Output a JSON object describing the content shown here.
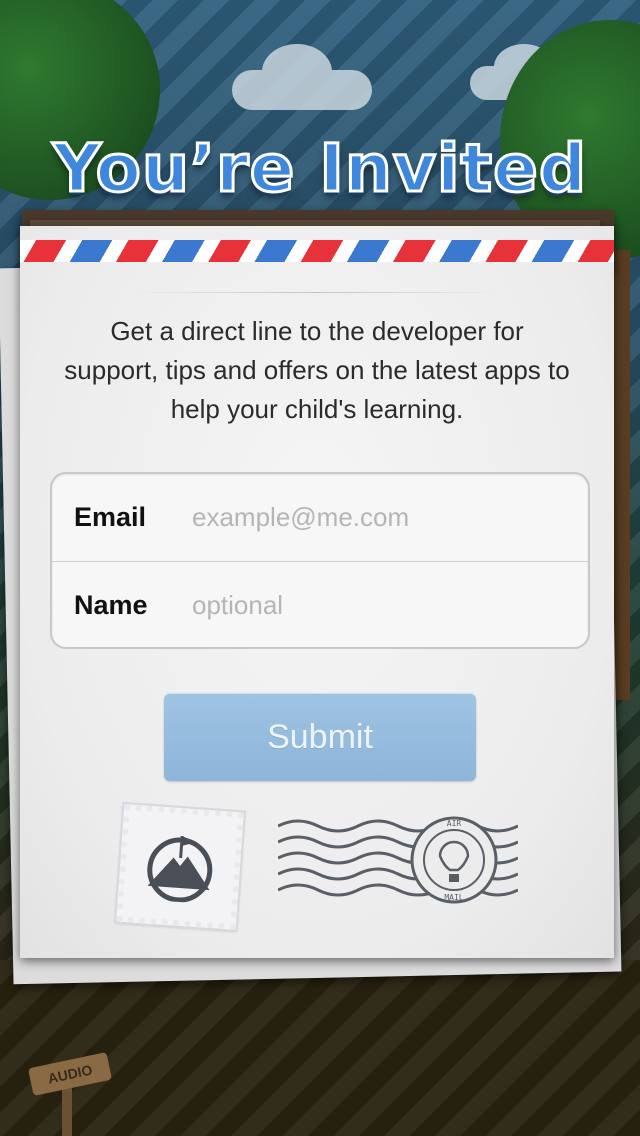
{
  "title": "You’re Invited",
  "intro_text": "Get a direct line to the developer for support, tips and offers on the latest apps to help your child's learning.",
  "form": {
    "email_label": "Email",
    "email_placeholder": "example@me.com",
    "name_label": "Name",
    "name_placeholder": "optional"
  },
  "submit_label": "Submit",
  "background": {
    "audio_sign_label": "AUDIO"
  },
  "postmark_text": {
    "top": "AIR",
    "bottom": "MAIL"
  },
  "colors": {
    "title_fill": "#3f87dc",
    "airmail_red": "#e7323a",
    "airmail_blue": "#3b78cf",
    "submit_bg": "#8db6da"
  },
  "icons": [
    "mountain-flag-stamp-icon",
    "air-balloon-postmark-icon"
  ]
}
